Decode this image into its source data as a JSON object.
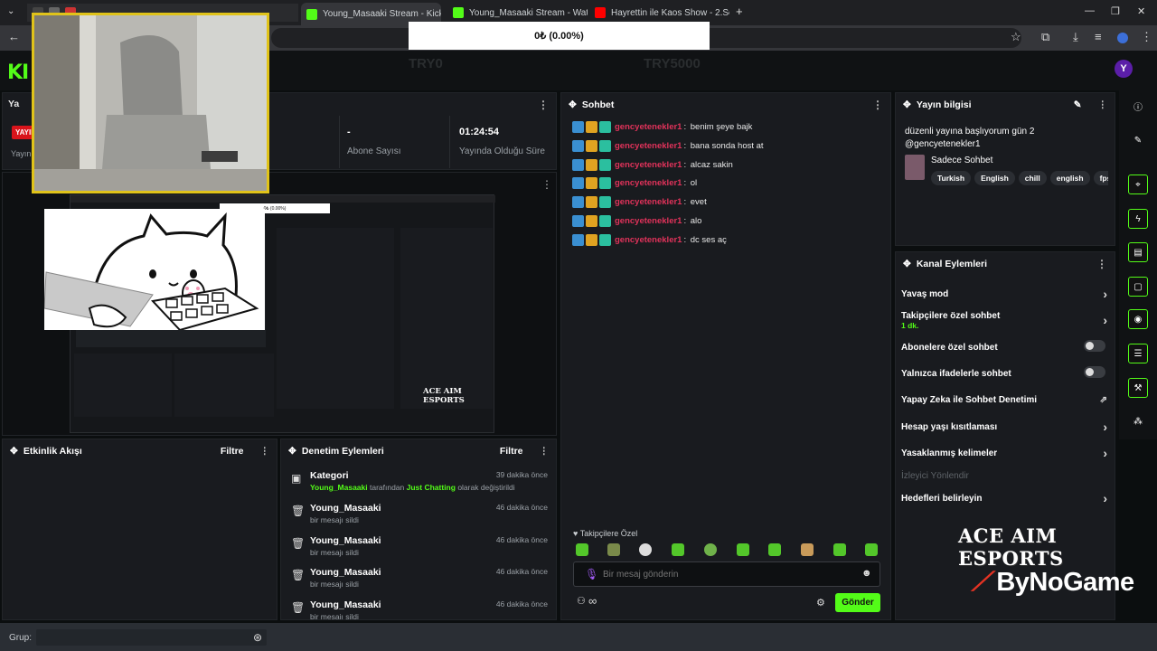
{
  "browser": {
    "tabs": [
      {
        "label": "Young_Masaaki Stream - Kick D",
        "active": true,
        "favicon_color": "#53fc18"
      },
      {
        "label": "Young_Masaaki Stream - Wat...",
        "active": false,
        "favicon_color": "#53fc18"
      },
      {
        "label": "Hayrettin ile Kaos Show - 2.Se",
        "active": false,
        "favicon_color": "#ff0000"
      }
    ],
    "new_tab": "+",
    "close": "×"
  },
  "alert": {
    "text": "0₺ (0.00%)"
  },
  "stream_header": {
    "ghost_left": "TRY0",
    "ghost_right": "TRY5000",
    "user_initial": "Y"
  },
  "live_panel": {
    "live_badge": "YAYIN",
    "title_cut": "Ya",
    "yayin_cut": "Yayın"
  },
  "stats": [
    {
      "value": "-",
      "label": "Abone Sayısı"
    },
    {
      "value": "01:24:54",
      "label": "Yayında Olduğu Süre"
    }
  ],
  "chat": {
    "title": "Sohbet",
    "username": "gencyetenekler1",
    "messages": [
      {
        "text": "benim şeye bajk"
      },
      {
        "text": "bana sonda host at"
      },
      {
        "text": "alcaz sakin"
      },
      {
        "text": "ol"
      },
      {
        "text": "evet"
      },
      {
        "text": "alo"
      },
      {
        "text": "dc ses aç"
      }
    ],
    "followers_only": "Takipçilere Özel",
    "input_placeholder": "Bir mesaj gönderin",
    "send_label": "Gönder",
    "infinity": "∞"
  },
  "stream_info": {
    "title": "Yayın bilgisi",
    "stream_title": "düzenli yayına başlıyorum gün 2 @gencyetenekler1",
    "category": "Sadece Sohbet",
    "tags": [
      "Turkish",
      "English",
      "chill",
      "english",
      "fps"
    ]
  },
  "channel_actions": {
    "title": "Kanal Eylemleri",
    "items": [
      {
        "label": "Yavaş mod",
        "control": "chevron"
      },
      {
        "label": "Takipçilere özel sohbet",
        "sub": "1 dk.",
        "control": "chevron"
      },
      {
        "label": "Abonelere özel sohbet",
        "control": "toggle"
      },
      {
        "label": "Yalnızca ifadelerle sohbet",
        "control": "toggle"
      },
      {
        "label": "Yapay Zeka ile Sohbet Denetimi",
        "control": "external"
      },
      {
        "label": "Hesap yaşı kısıtlaması",
        "control": "chevron"
      },
      {
        "label": "Yasaklanmış kelimeler",
        "control": "chevron"
      },
      {
        "label": "İzleyici Yönlendir",
        "control": "none",
        "disabled": true
      },
      {
        "label": "Hedefleri belirleyin",
        "control": "chevron"
      }
    ]
  },
  "activity": {
    "title": "Etkinlik Akışı",
    "filter": "Filtre"
  },
  "mod_actions": {
    "title": "Denetim Eylemleri",
    "filter": "Filtre",
    "items": [
      {
        "title": "Kategori",
        "user": "Young_Masaaki",
        "mid": " tarafından ",
        "cat": "Just Chatting",
        "end": " olarak değiştirildi",
        "time": "39 dakika önce",
        "icon": "category-icon"
      },
      {
        "title": "Young_Masaaki",
        "sub": "bir mesajı sildi",
        "time": "46 dakika önce",
        "icon": "trash-icon"
      },
      {
        "title": "Young_Masaaki",
        "sub": "bir mesajı sildi",
        "time": "46 dakika önce",
        "icon": "trash-icon"
      },
      {
        "title": "Young_Masaaki",
        "sub": "bir mesajı sildi",
        "time": "46 dakika önce",
        "icon": "trash-icon"
      },
      {
        "title": "Young_Masaaki",
        "sub": "bir mesajı sildi",
        "time": "46 dakika önce",
        "icon": "trash-icon"
      }
    ]
  },
  "overlay": {
    "ace": "ACE AIM ESPORTS",
    "bynogame": "ByNoGame"
  },
  "bottom": {
    "group_label": "Grup:"
  },
  "preview": {
    "ace": "ACE AIM ESPORTS",
    "alert": "0₺ (0.00%)"
  }
}
